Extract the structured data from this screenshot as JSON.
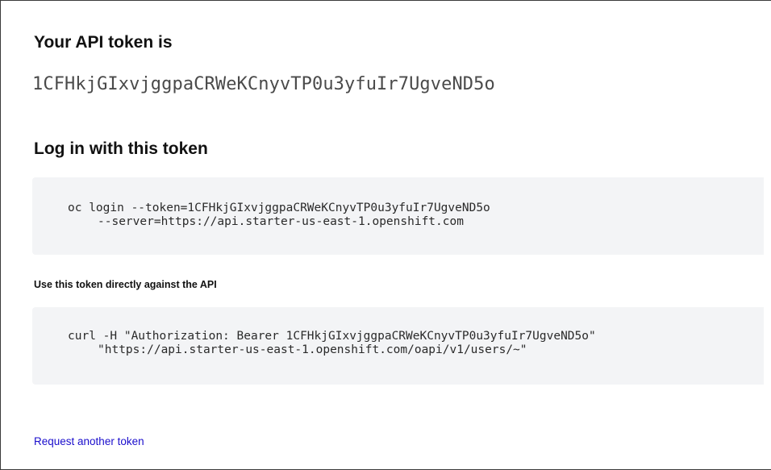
{
  "token_section": {
    "heading": "Your API token is",
    "token": "1CFHkjGIxvjggpaCRWeKCnyvTP0u3yfuIr7UgveND5o"
  },
  "login_section": {
    "heading": "Log in with this token",
    "command_line1": "oc login --token=1CFHkjGIxvjggpaCRWeKCnyvTP0u3yfuIr7UgveND5o",
    "command_line2": "--server=https://api.starter-us-east-1.openshift.com"
  },
  "api_section": {
    "heading": "Use this token directly against the API",
    "command_line1": "curl -H \"Authorization: Bearer 1CFHkjGIxvjggpaCRWeKCnyvTP0u3yfuIr7UgveND5o\"",
    "command_line2": "\"https://api.starter-us-east-1.openshift.com/oapi/v1/users/~\""
  },
  "footer": {
    "request_link": "Request another token"
  },
  "colors": {
    "code_background": "#f3f4f6",
    "link": "#1a0dcc"
  }
}
